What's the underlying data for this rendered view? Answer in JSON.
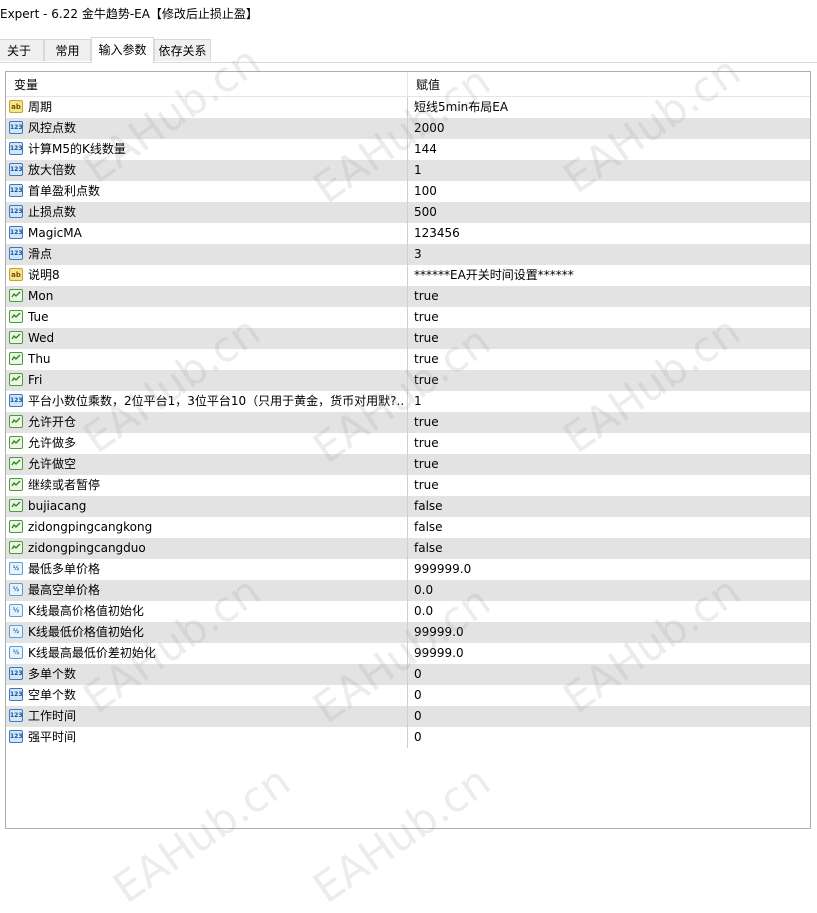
{
  "window": {
    "title": "Expert - 6.22  金牛趋势-EA【修改后止损止盈】"
  },
  "tabs": [
    {
      "label": "关于"
    },
    {
      "label": "常用"
    },
    {
      "label": "输入参数"
    },
    {
      "label": "依存关系"
    }
  ],
  "table": {
    "headers": {
      "variable": "变量",
      "value": "赋值"
    },
    "rows": [
      {
        "type": "string",
        "name": "周期",
        "value": "短线5min布局EA"
      },
      {
        "type": "int",
        "name": "风控点数",
        "value": "2000"
      },
      {
        "type": "int",
        "name": "计算M5的K线数量",
        "value": "144"
      },
      {
        "type": "int",
        "name": "放大倍数",
        "value": "1"
      },
      {
        "type": "int",
        "name": "首单盈利点数",
        "value": "100"
      },
      {
        "type": "int",
        "name": "止损点数",
        "value": "500"
      },
      {
        "type": "int",
        "name": "MagicMA",
        "value": "123456"
      },
      {
        "type": "int",
        "name": "滑点",
        "value": "3"
      },
      {
        "type": "string",
        "name": "说明8",
        "value": "******EA开关时间设置******"
      },
      {
        "type": "bool",
        "name": "Mon",
        "value": "true"
      },
      {
        "type": "bool",
        "name": "Tue",
        "value": "true"
      },
      {
        "type": "bool",
        "name": "Wed",
        "value": "true"
      },
      {
        "type": "bool",
        "name": "Thu",
        "value": "true"
      },
      {
        "type": "bool",
        "name": "Fri",
        "value": "true"
      },
      {
        "type": "int",
        "name": "平台小数位乘数，2位平台1，3位平台10（只用于黄金，货币对用默?..",
        "value": "1"
      },
      {
        "type": "bool",
        "name": "允许开仓",
        "value": "true"
      },
      {
        "type": "bool",
        "name": "允许做多",
        "value": "true"
      },
      {
        "type": "bool",
        "name": "允许做空",
        "value": "true"
      },
      {
        "type": "bool",
        "name": "继续或者暂停",
        "value": "true"
      },
      {
        "type": "bool",
        "name": "bujiacang",
        "value": "false"
      },
      {
        "type": "bool",
        "name": "zidongpingcangkong",
        "value": "false"
      },
      {
        "type": "bool",
        "name": "zidongpingcangduo",
        "value": "false"
      },
      {
        "type": "double",
        "name": "最低多单价格",
        "value": "999999.0"
      },
      {
        "type": "double",
        "name": "最高空单价格",
        "value": "0.0"
      },
      {
        "type": "double",
        "name": "K线最高价格值初始化",
        "value": "0.0"
      },
      {
        "type": "double",
        "name": "K线最低价格值初始化",
        "value": "99999.0"
      },
      {
        "type": "double",
        "name": "K线最高最低价差初始化",
        "value": "99999.0"
      },
      {
        "type": "int",
        "name": "多单个数",
        "value": "0"
      },
      {
        "type": "int",
        "name": "空单个数",
        "value": "0"
      },
      {
        "type": "int",
        "name": "工作时间",
        "value": "0"
      },
      {
        "type": "int",
        "name": "强平时间",
        "value": "0"
      }
    ]
  },
  "icons": {
    "string": {
      "name": "string-type-icon",
      "glyph": "ab"
    },
    "int": {
      "name": "integer-type-icon",
      "glyph": "123"
    },
    "double": {
      "name": "double-type-icon",
      "glyph": "½"
    },
    "bool": {
      "name": "boolean-type-icon",
      "glyph": ""
    }
  },
  "watermark": {
    "text": "EAHub.cn"
  },
  "colors": {
    "alt_row": "#e3e3e3",
    "border": "#adadad"
  }
}
